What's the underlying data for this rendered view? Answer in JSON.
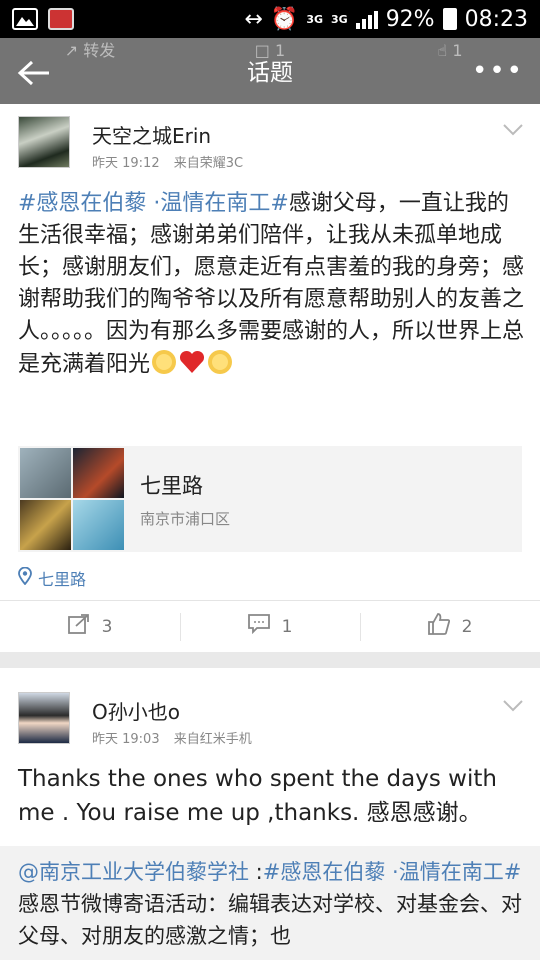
{
  "status": {
    "battery": "92%",
    "time": "08:23",
    "net1": "3G",
    "net2": "3G"
  },
  "header": {
    "title": "话题",
    "ghost_repost": "转发",
    "ghost_comments": "1",
    "ghost_likes": "1"
  },
  "post1": {
    "user": "天空之城Erin",
    "time": "昨天 19:12",
    "source": "来自荣耀3C",
    "hashtag": "#感恩在伯藜 ·温情在南工#",
    "text": "感谢父母，一直让我的生活很幸福；感谢弟弟们陪伴，让我从未孤单地成长；感谢朋友们，愿意走近有点害羞的我的身旁；感谢帮助我们的陶爷爷以及所有愿意帮助别人的友善之人。。。。。因为有那么多需要感谢的人，所以世界上总是充满着阳光",
    "place_name": "七里路",
    "place_addr": "南京市浦口区",
    "location": "七里路",
    "reposts": "3",
    "comments": "1",
    "likes": "2"
  },
  "post2": {
    "user": "O孙小也o",
    "time": "昨天 19:03",
    "source": "来自红米手机",
    "text": "Thanks the ones who spent the days with me . You raise me up ,thanks. 感恩感谢。",
    "quote_mention": "@南京工业大学伯藜学社",
    "quote_sep": " :",
    "quote_hashtag": "#感恩在伯藜 ·温情在南工#",
    "quote_text": "感恩节微博寄语活动：编辑表达对学校、对基金会、对父母、对朋友的感激之情；也"
  }
}
